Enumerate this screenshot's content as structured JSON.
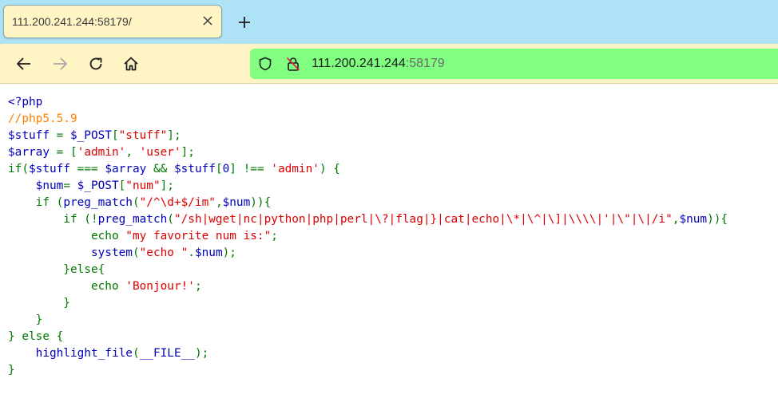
{
  "tab": {
    "title": "111.200.241.244:58179/"
  },
  "address_bar": {
    "host": "111.200.241.244",
    "port": ":58179"
  },
  "icons": {
    "close": "close-icon",
    "new_tab": "plus-icon",
    "back": "back-arrow-icon",
    "forward": "forward-arrow-icon",
    "reload": "reload-icon",
    "home": "home-icon",
    "shield": "shield-icon",
    "insecure_lock": "insecure-lock-icon"
  },
  "colors": {
    "tabbar_bg": "#aee3f7",
    "toolbar_bg": "#fff4c4",
    "urlbar_bg": "#80ff80",
    "php_default": "#0000bb",
    "php_keyword": "#007700",
    "php_string": "#dd0000",
    "php_comment": "#ff8000"
  },
  "code_lines": [
    [
      {
        "t": "<?php",
        "c": "d"
      }
    ],
    [
      {
        "t": "//php5.5.9",
        "c": "c"
      }
    ],
    [
      {
        "t": "$stuff ",
        "c": "d"
      },
      {
        "t": "= ",
        "c": "k"
      },
      {
        "t": "$_POST",
        "c": "d"
      },
      {
        "t": "[",
        "c": "k"
      },
      {
        "t": "\"stuff\"",
        "c": "s"
      },
      {
        "t": "];",
        "c": "k"
      }
    ],
    [
      {
        "t": "$array ",
        "c": "d"
      },
      {
        "t": "= [",
        "c": "k"
      },
      {
        "t": "'admin'",
        "c": "s"
      },
      {
        "t": ", ",
        "c": "k"
      },
      {
        "t": "'user'",
        "c": "s"
      },
      {
        "t": "];",
        "c": "k"
      }
    ],
    [
      {
        "t": "if(",
        "c": "k"
      },
      {
        "t": "$stuff ",
        "c": "d"
      },
      {
        "t": "=== ",
        "c": "k"
      },
      {
        "t": "$array ",
        "c": "d"
      },
      {
        "t": "&& ",
        "c": "k"
      },
      {
        "t": "$stuff",
        "c": "d"
      },
      {
        "t": "[",
        "c": "k"
      },
      {
        "t": "0",
        "c": "d"
      },
      {
        "t": "] !== ",
        "c": "k"
      },
      {
        "t": "'admin'",
        "c": "s"
      },
      {
        "t": ") {",
        "c": "k"
      }
    ],
    [
      {
        "t": "    ",
        "c": "k"
      },
      {
        "t": "$num",
        "c": "d"
      },
      {
        "t": "= ",
        "c": "k"
      },
      {
        "t": "$_POST",
        "c": "d"
      },
      {
        "t": "[",
        "c": "k"
      },
      {
        "t": "\"num\"",
        "c": "s"
      },
      {
        "t": "];",
        "c": "k"
      }
    ],
    [
      {
        "t": "    if (",
        "c": "k"
      },
      {
        "t": "preg_match",
        "c": "d"
      },
      {
        "t": "(",
        "c": "k"
      },
      {
        "t": "\"/^\\d+$/im\"",
        "c": "s"
      },
      {
        "t": ",",
        "c": "k"
      },
      {
        "t": "$num",
        "c": "d"
      },
      {
        "t": ")){",
        "c": "k"
      }
    ],
    [
      {
        "t": "        if (!",
        "c": "k"
      },
      {
        "t": "preg_match",
        "c": "d"
      },
      {
        "t": "(",
        "c": "k"
      },
      {
        "t": "\"/sh|wget|nc|python|php|perl|\\?|flag|}|cat|echo|\\*|\\^|\\]|\\\\\\\\|'|\\\"|\\|/i\"",
        "c": "s"
      },
      {
        "t": ",",
        "c": "k"
      },
      {
        "t": "$num",
        "c": "d"
      },
      {
        "t": ")){",
        "c": "k"
      }
    ],
    [
      {
        "t": "            echo ",
        "c": "k"
      },
      {
        "t": "\"my favorite num is:\"",
        "c": "s"
      },
      {
        "t": ";",
        "c": "k"
      }
    ],
    [
      {
        "t": "            ",
        "c": "k"
      },
      {
        "t": "system",
        "c": "d"
      },
      {
        "t": "(",
        "c": "k"
      },
      {
        "t": "\"echo \"",
        "c": "s"
      },
      {
        "t": ".",
        "c": "k"
      },
      {
        "t": "$num",
        "c": "d"
      },
      {
        "t": ");",
        "c": "k"
      }
    ],
    [
      {
        "t": "        }else{",
        "c": "k"
      }
    ],
    [
      {
        "t": "            echo ",
        "c": "k"
      },
      {
        "t": "'Bonjour!'",
        "c": "s"
      },
      {
        "t": ";",
        "c": "k"
      }
    ],
    [
      {
        "t": "        }",
        "c": "k"
      }
    ],
    [
      {
        "t": "    }",
        "c": "k"
      }
    ],
    [
      {
        "t": "} else {",
        "c": "k"
      }
    ],
    [
      {
        "t": "    ",
        "c": "k"
      },
      {
        "t": "highlight_file",
        "c": "d"
      },
      {
        "t": "(",
        "c": "k"
      },
      {
        "t": "__FILE__",
        "c": "d"
      },
      {
        "t": ");",
        "c": "k"
      }
    ],
    [
      {
        "t": "}",
        "c": "k"
      }
    ]
  ]
}
